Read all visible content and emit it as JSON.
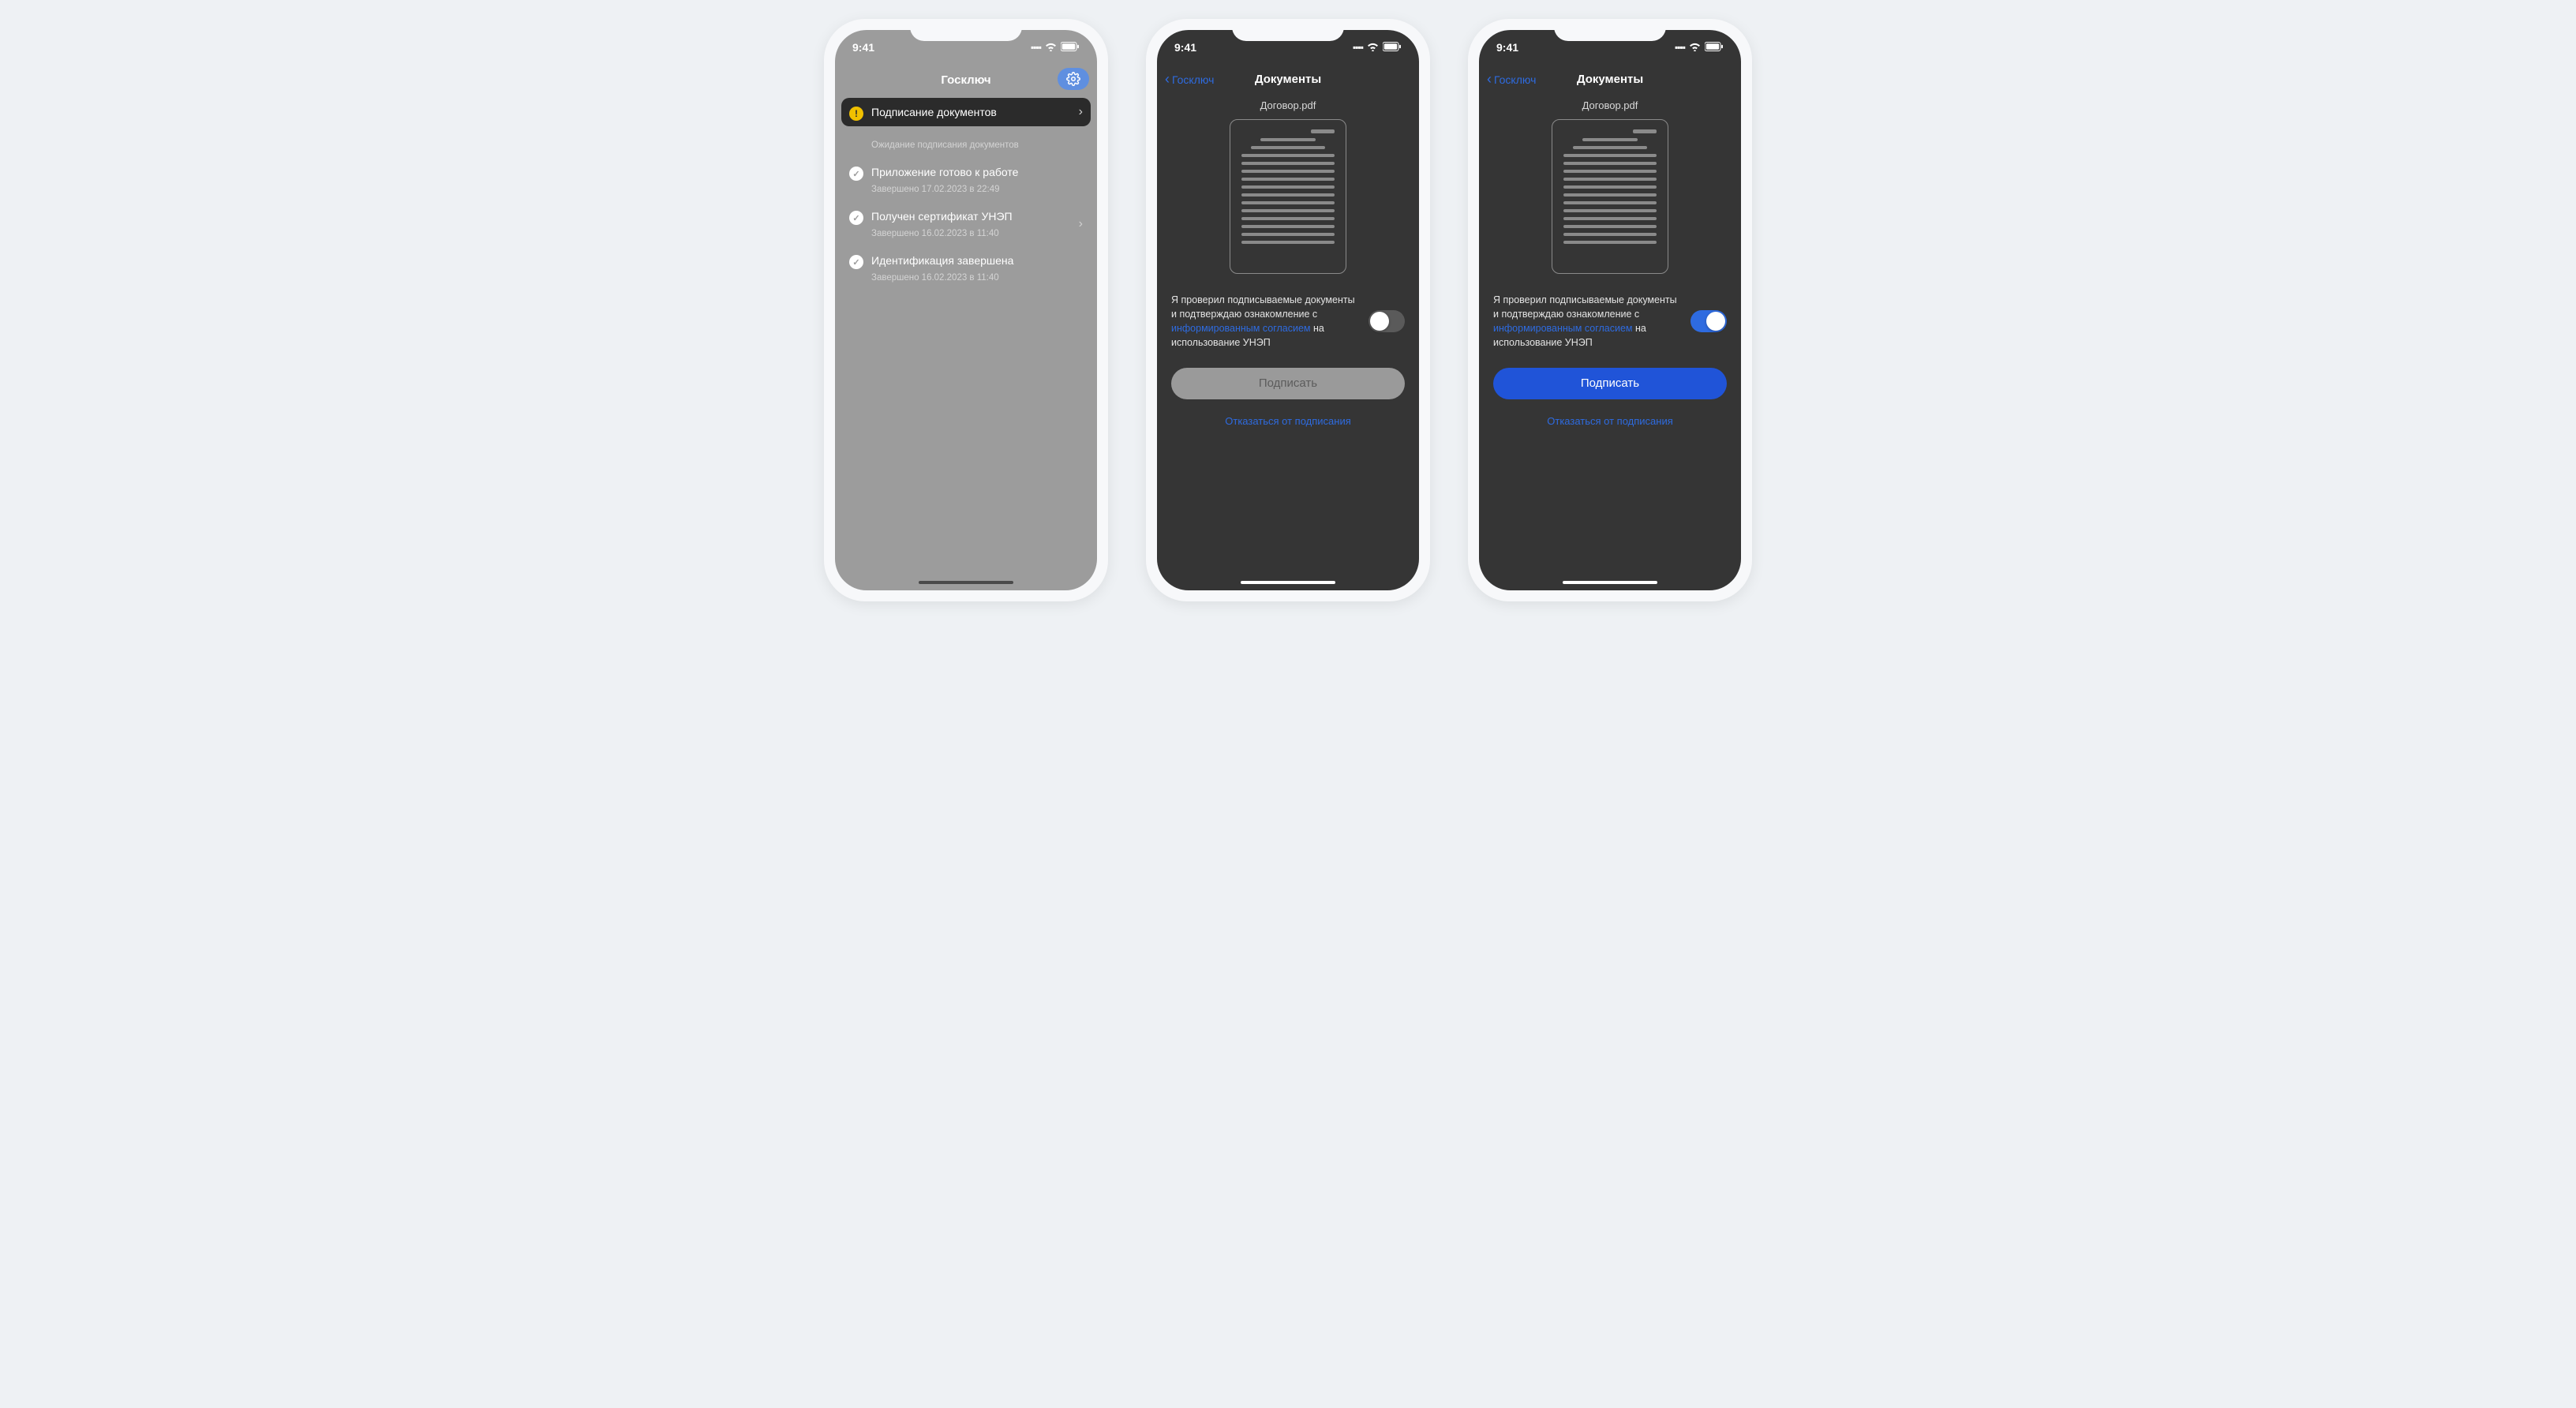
{
  "status_time": "9:41",
  "screen1": {
    "title": "Госключ",
    "items": [
      {
        "title": "Подписание документов",
        "subtitle": "Ожидание подписания документов",
        "status": "warn",
        "chevron": true
      },
      {
        "title": "Приложение готово к работе",
        "subtitle": "Завершено 17.02.2023 в 22:49",
        "status": "check",
        "chevron": false
      },
      {
        "title": "Получен сертификат УНЭП",
        "subtitle": "Завершено 16.02.2023 в 11:40",
        "status": "check",
        "chevron": true
      },
      {
        "title": "Идентификация завершена",
        "subtitle": "Завершено 16.02.2023 в 11:40",
        "status": "check",
        "chevron": false
      }
    ]
  },
  "screen2": {
    "back_label": "Госключ",
    "title": "Документы",
    "filename": "Договор.pdf",
    "consent_part1": "Я проверил подписываемые документы и подтверждаю ознакомление с ",
    "consent_link": "информированным согласием",
    "consent_part2": " на использование УНЭП",
    "toggle_on": false,
    "sign_label": "Подписать",
    "decline_label": "Отказаться от подписания"
  },
  "screen3": {
    "back_label": "Госключ",
    "title": "Документы",
    "filename": "Договор.pdf",
    "consent_part1": "Я проверил подписываемые документы и подтверждаю ознакомление с ",
    "consent_link": "информированным согласием",
    "consent_part2": " на использование УНЭП",
    "toggle_on": true,
    "sign_label": "Подписать",
    "decline_label": "Отказаться от подписания"
  }
}
